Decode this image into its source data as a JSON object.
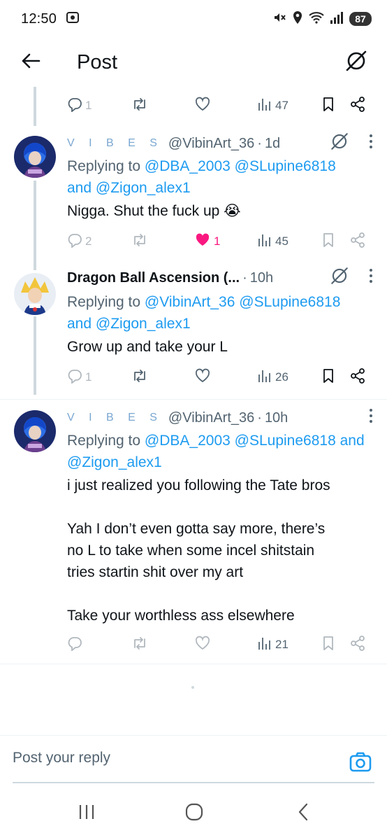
{
  "status_bar": {
    "time": "12:50",
    "battery": "87"
  },
  "header": {
    "title": "Post"
  },
  "top_actions": {
    "replies": "1",
    "likes": "",
    "views": "47"
  },
  "tweets": [
    {
      "name": "V I B E S",
      "handle": "@VibinArt_36",
      "time": "1d",
      "replying_prefix": "Replying to",
      "mention1": "@DBA_2003",
      "mention2": "@SLupine6818",
      "conj": "and",
      "mention3": "@Zigon_alex1",
      "text": "Nigga. Shut the fuck up 😭",
      "replies": "2",
      "likes": "1",
      "views": "45"
    },
    {
      "name": "Dragon Ball Ascension (...",
      "handle": "",
      "time": "10h",
      "replying_prefix": "Replying to",
      "mention1": "@VibinArt_36",
      "mention2": "@SLupine6818",
      "conj": "and",
      "mention3": "@Zigon_alex1",
      "text": "Grow up and take your L",
      "replies": "1",
      "likes": "",
      "views": "26"
    },
    {
      "name": "V I B E S",
      "handle": "@VibinArt_36",
      "time": "10h",
      "replying_prefix": "Replying to",
      "mention1": "@DBA_2003",
      "mention2": "@SLupine6818",
      "conj": "and",
      "mention3": "@Zigon_alex1",
      "text_lines": [
        "i just realized you following the Tate bros",
        "",
        "Yah I don’t even gotta say more, there’s",
        "no L to take when some incel shitstain",
        "tries startin shit over my art",
        "",
        "Take your worthless ass elsewhere"
      ],
      "replies": "",
      "likes": "",
      "views": "21"
    }
  ],
  "reply_bar": {
    "placeholder": "Post your reply"
  },
  "colors": {
    "accent": "#1d9bf0",
    "like": "#f91880",
    "text": "#0f1419",
    "muted": "#536471"
  },
  "icons": [
    "back-arrow-icon",
    "grok-icon",
    "reply-icon",
    "repost-icon",
    "heart-icon",
    "views-icon",
    "bookmark-icon",
    "share-icon",
    "more-icon",
    "camera-icon"
  ]
}
